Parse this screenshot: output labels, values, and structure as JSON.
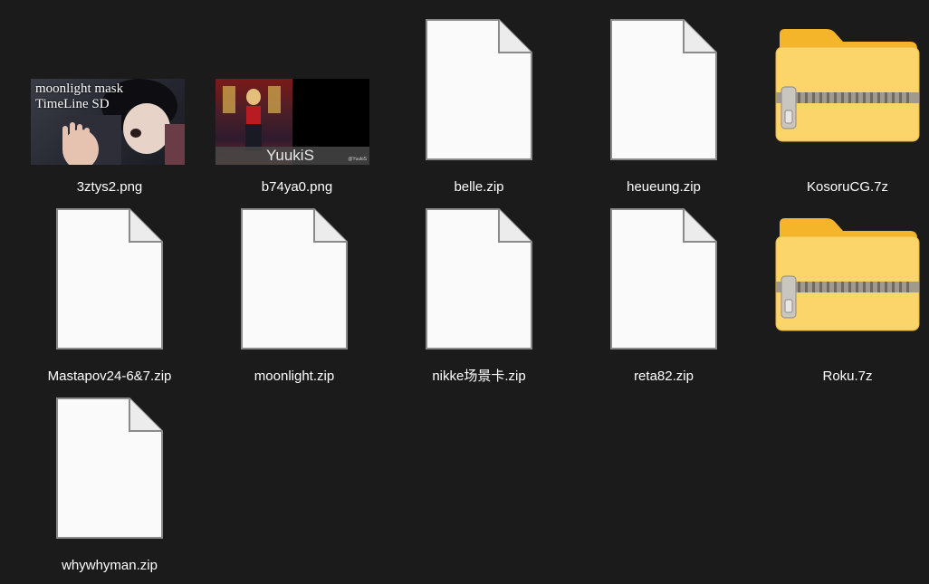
{
  "files": [
    {
      "name": "3ztys2.png",
      "kind": "image",
      "preview_line1": "moonlight mask",
      "preview_line2": "TimeLine SD"
    },
    {
      "name": "b74ya0.png",
      "kind": "image",
      "preview_text": "YuukiS",
      "preview_credit": "@YuukiS"
    },
    {
      "name": "belle.zip",
      "kind": "file"
    },
    {
      "name": "heueung.zip",
      "kind": "file"
    },
    {
      "name": "KosoruCG.7z",
      "kind": "archive"
    },
    {
      "name": "Mastapov24-6&7.zip",
      "kind": "file"
    },
    {
      "name": "moonlight.zip",
      "kind": "file"
    },
    {
      "name": "nikke场景卡.zip",
      "kind": "file"
    },
    {
      "name": "reta82.zip",
      "kind": "file"
    },
    {
      "name": "Roku.7z",
      "kind": "archive"
    },
    {
      "name": "whywhyman.zip",
      "kind": "file"
    }
  ],
  "icons": {
    "file": "blank-document-icon",
    "archive": "zipped-folder-icon",
    "image": "image-thumbnail"
  },
  "colors": {
    "background": "#1b1b1b",
    "label": "#ffffff",
    "folder_yellow": "#fbd569",
    "document": "#fafafa"
  }
}
